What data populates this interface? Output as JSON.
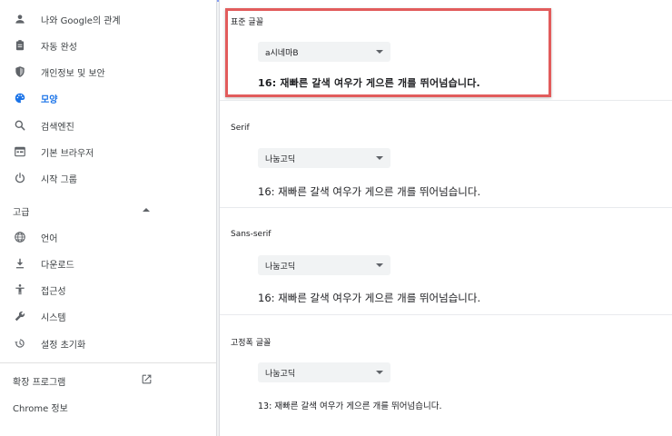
{
  "sidebar": {
    "items": [
      {
        "label": "나와 Google의 관계",
        "icon": "person-icon"
      },
      {
        "label": "자동 완성",
        "icon": "clipboard-icon"
      },
      {
        "label": "개인정보 및 보안",
        "icon": "shield-icon"
      },
      {
        "label": "모양",
        "icon": "palette-icon",
        "active": true
      },
      {
        "label": "검색엔진",
        "icon": "search-icon"
      },
      {
        "label": "기본 브라우저",
        "icon": "browser-icon"
      },
      {
        "label": "시작 그룹",
        "icon": "power-icon"
      }
    ],
    "advanced_label": "고급",
    "advanced_items": [
      {
        "label": "언어",
        "icon": "globe-icon"
      },
      {
        "label": "다운로드",
        "icon": "download-icon"
      },
      {
        "label": "접근성",
        "icon": "accessibility-icon"
      },
      {
        "label": "시스템",
        "icon": "wrench-icon"
      },
      {
        "label": "설정 초기화",
        "icon": "history-icon"
      }
    ],
    "extensions_label": "확장 프로그램",
    "about_label": "Chrome 정보"
  },
  "fonts": [
    {
      "title": "표준 글꼴",
      "selected": "a시네마B",
      "sample": "16: 재빠른 갈색 여우가 게으른 개를 뛰어넘습니다."
    },
    {
      "title": "Serif",
      "selected": "나눔고딕",
      "sample": "16: 재빠른 갈색 여우가 게으른 개를 뛰어넘습니다."
    },
    {
      "title": "Sans-serif",
      "selected": "나눔고딕",
      "sample": "16: 재빠른 갈색 여우가 게으른 개를 뛰어넘습니다."
    },
    {
      "title": "고정폭 글꼴",
      "selected": "나눔고딕",
      "sample": "13: 재빠른 갈색 여우가 게으른 개를 뛰어넘습니다."
    }
  ],
  "colors": {
    "accent": "#1a73e8",
    "highlight_border": "#e25c5c"
  }
}
